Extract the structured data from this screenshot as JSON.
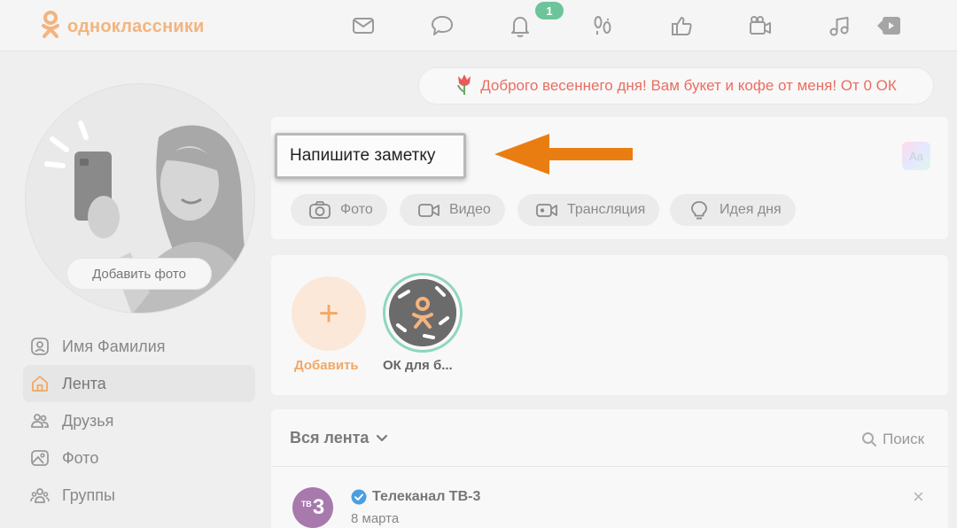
{
  "brand": {
    "name": "одноклассники",
    "accent": "#f3b47e"
  },
  "topnav": {
    "items": [
      "mail-icon",
      "chat-icon",
      "bell-icon",
      "footprints-icon",
      "thumbs-up-icon",
      "video-camera-icon",
      "music-note-icon",
      "video-play-icon"
    ],
    "notifications_count": "1"
  },
  "promo": {
    "text": "Доброго весеннего дня! Вам букет и кофе от меня! От 0 ОК",
    "icon": "tulip-icon"
  },
  "profile": {
    "add_photo": "Добавить фото"
  },
  "menu": {
    "items": [
      {
        "label": "Имя Фамилия",
        "icon": "user-icon"
      },
      {
        "label": "Лента",
        "icon": "home-icon",
        "active": true
      },
      {
        "label": "Друзья",
        "icon": "friends-icon"
      },
      {
        "label": "Фото",
        "icon": "photo-icon"
      },
      {
        "label": "Группы",
        "icon": "groups-icon"
      }
    ]
  },
  "composer": {
    "placeholder": "Напишите заметку",
    "font_button": "Aa",
    "chips": [
      {
        "label": "Фото",
        "icon": "camera-icon"
      },
      {
        "label": "Видео",
        "icon": "video-icon"
      },
      {
        "label": "Трансляция",
        "icon": "broadcast-icon"
      },
      {
        "label": "Идея дня",
        "icon": "lightbulb-icon"
      }
    ]
  },
  "stories": {
    "add_label": "Добавить",
    "add_symbol": "+",
    "items": [
      {
        "label": "ОК для б..."
      }
    ]
  },
  "feed": {
    "title": "Вся лента",
    "search_label": "Поиск",
    "post": {
      "author": "Телеканал ТВ-3",
      "date": "8 марта",
      "verified": true,
      "avatar_text_small": "ТВ",
      "avatar_text_big": "3",
      "close_symbol": "×"
    }
  }
}
